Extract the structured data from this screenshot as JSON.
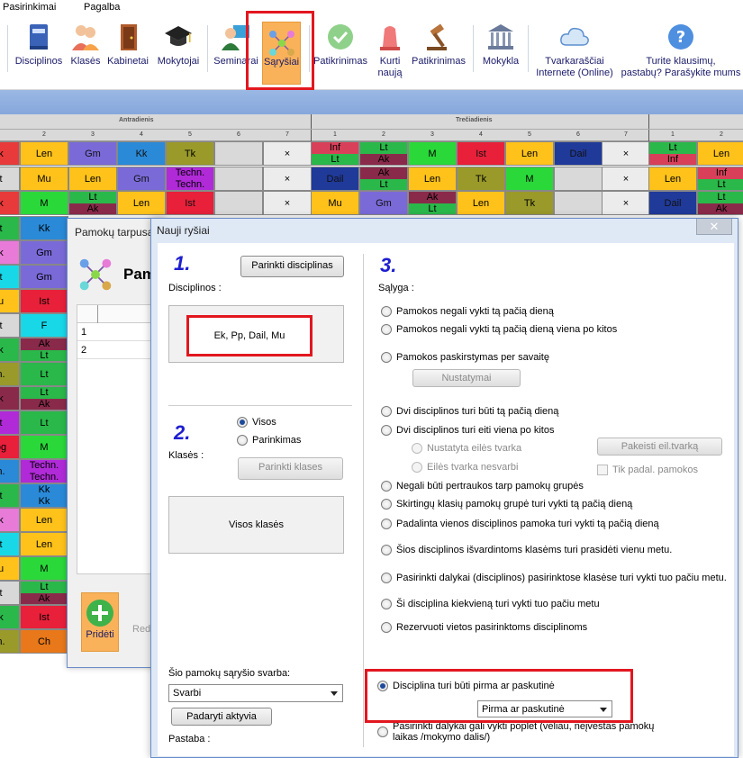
{
  "menu": [
    "Pasirinkimai",
    "Pagalba"
  ],
  "ribbon": [
    {
      "label": "Disciplinos",
      "icon": "book-icon"
    },
    {
      "label": "Klasės",
      "icon": "students-icon"
    },
    {
      "label": "Kabinetai",
      "icon": "door-icon"
    },
    {
      "label": "Mokytojai",
      "icon": "graduation-cap-icon"
    },
    {
      "label": "Seminarai",
      "icon": "teacher-board-icon"
    },
    {
      "label": "Sąryšiai",
      "icon": "network-icon"
    },
    {
      "label": "Patikrinimas",
      "icon": "check-badge-icon"
    },
    {
      "label": "Kurti\nnaują",
      "icon": "siren-icon"
    },
    {
      "label": "Patikrinimas",
      "icon": "gavel-icon"
    },
    {
      "label": "Mokykla",
      "icon": "building-icon"
    },
    {
      "label": "Tvarkaraščiai\nInternete (Online)",
      "icon": "cloud-icon"
    },
    {
      "label": "Turite klausimų,\npastabų? Parašykite mums",
      "icon": "question-icon"
    }
  ],
  "timetable": {
    "days": [
      "Antradienis",
      "Trečiadienis"
    ],
    "cols": [
      "2",
      "3",
      "4",
      "5",
      "6",
      "7",
      "1",
      "2",
      "3",
      "4",
      "5",
      "6",
      "7",
      "1",
      "2"
    ],
    "rows": [
      [
        [
          "k"
        ],
        [
          "Len"
        ],
        [
          "Gm"
        ],
        [
          "Kk"
        ],
        [
          "Tk"
        ],
        [
          ""
        ],
        [
          "×"
        ],
        [
          "Inf",
          "Lt"
        ],
        [
          "Lt",
          "Ak"
        ],
        [
          "M"
        ],
        [
          "Ist"
        ],
        [
          "Len"
        ],
        [
          "Dail"
        ],
        [
          "×"
        ],
        [
          "Lt",
          "Inf"
        ],
        [
          "Len"
        ]
      ],
      [
        [
          "t"
        ],
        [
          "Mu"
        ],
        [
          "Len"
        ],
        [
          "Gm"
        ],
        [
          "Techn.",
          "Techn."
        ],
        [
          ""
        ],
        [
          "×"
        ],
        [
          "Dail"
        ],
        [
          "Ak",
          "Lt"
        ],
        [
          "Len"
        ],
        [
          "Tk"
        ],
        [
          "M"
        ],
        [
          ""
        ],
        [
          "×"
        ],
        [
          "Len"
        ],
        [
          "Inf",
          "Lt"
        ]
      ],
      [
        [
          "k"
        ],
        [
          "M"
        ],
        [
          "Lt",
          "Ak"
        ],
        [
          "Len"
        ],
        [
          "Ist"
        ],
        [
          ""
        ],
        [
          "×"
        ],
        [
          "Mu"
        ],
        [
          "Gm"
        ],
        [
          "Ak",
          "Lt"
        ],
        [
          "Len"
        ],
        [
          "Tk"
        ],
        [
          ""
        ],
        [
          "×"
        ],
        [
          "Dail"
        ],
        [
          "Lt",
          "Ak"
        ]
      ]
    ],
    "leftcol": [
      "Kk",
      "Gm",
      "Gm",
      "Ist",
      "F",
      "Ak",
      "Lt",
      "Lt",
      "Ak",
      "Lt",
      "M",
      "Techn.",
      "Techn.",
      "Kk",
      "Kk",
      "Len",
      "Len",
      "M",
      "Lt",
      "Ak",
      "Ist",
      "Ch"
    ],
    "leftstub": [
      "t",
      "k",
      "t",
      "u",
      "t",
      "k",
      "n.",
      "k",
      "t",
      "og",
      "n."
    ]
  },
  "back_dialog": {
    "title": "Pamokų tarpusa",
    "header": "Pam",
    "rows": [
      "1",
      "2"
    ],
    "add_label": "Pridėti",
    "edit_label": "Redag"
  },
  "dialog": {
    "title": "Nauji ryšiai",
    "step1": "1.",
    "step2": "2.",
    "step3": "3.",
    "choose_subjects_btn": "Parinkti disciplinas",
    "subjects_label": "Disciplinos :",
    "subjects_value": "Ek, Pp, Dail, Mu",
    "classes_label": "Klasės :",
    "classes_radio_all": "Visos",
    "classes_radio_select": "Parinkimas",
    "choose_classes_btn": "Parinkti klases",
    "classes_value": "Visos klasės",
    "weight_label": "Šio pamokų sąryšio svarba:",
    "weight_value": "Svarbi",
    "activate_btn": "Padaryti aktyvia",
    "note_label": "Pastaba :",
    "condition_label": "Sąlyga :",
    "settings_btn": "Nustatymai",
    "change_order_btn": "Pakeisti eil.tvarką",
    "options": [
      {
        "label": "Pamokos negali vykti tą pačią dieną",
        "checked": false,
        "disabled": false
      },
      {
        "label": "Pamokos negali vykti tą pačią dieną viena po kitos",
        "checked": false,
        "disabled": false
      },
      {
        "label": "Pamokos paskirstymas per savaitę",
        "checked": false,
        "disabled": false
      },
      {
        "label": "Dvi disciplinos turi būti tą pačią dieną",
        "checked": false,
        "disabled": false
      },
      {
        "label": "Dvi disciplinos turi eiti viena po kitos",
        "checked": false,
        "disabled": false
      },
      {
        "label": "Nustatyta eilės tvarka",
        "checked": false,
        "disabled": true
      },
      {
        "label": "Eilės tvarka nesvarbi",
        "checked": false,
        "disabled": true
      },
      {
        "label": "Negali būti pertraukos tarp pamokų grupės",
        "checked": false,
        "disabled": false
      },
      {
        "label": "Skirtingų klasių pamokų grupė turi vykti tą pačią dieną",
        "checked": false,
        "disabled": false
      },
      {
        "label": "Padalinta vienos disciplinos pamoka turi vykti tą pačią dieną",
        "checked": false,
        "disabled": false
      },
      {
        "label": "Šios disciplinos išvardintoms klasėms turi prasidėti vienu metu.",
        "checked": false,
        "disabled": false
      },
      {
        "label": "Pasirinkti dalykai (disciplinos) pasirinktose klasėse turi vykti tuo pačiu metu.",
        "checked": false,
        "disabled": false
      },
      {
        "label": "Ši disciplina kiekvieną turi vykti tuo pačiu metu",
        "checked": false,
        "disabled": false
      },
      {
        "label": "Rezervuoti vietos pasirinktoms disciplinoms",
        "checked": false,
        "disabled": false
      },
      {
        "label": "Disciplina turi būti pirma ar paskutinė",
        "checked": true,
        "disabled": false
      },
      {
        "label": "Pasirinkti dalykai gali vykti poplet (vėliau, neįvestas pamokų laikas /mokymo dalis/)",
        "checked": false,
        "disabled": false
      }
    ],
    "tik_padal": "Tik padal. pamokos",
    "first_last_value": "Pirma ar paskutinė"
  },
  "colors": {
    "highlight": "#e2171f",
    "step_number": "#1e1ed0",
    "active_button": "#f9b25a"
  }
}
